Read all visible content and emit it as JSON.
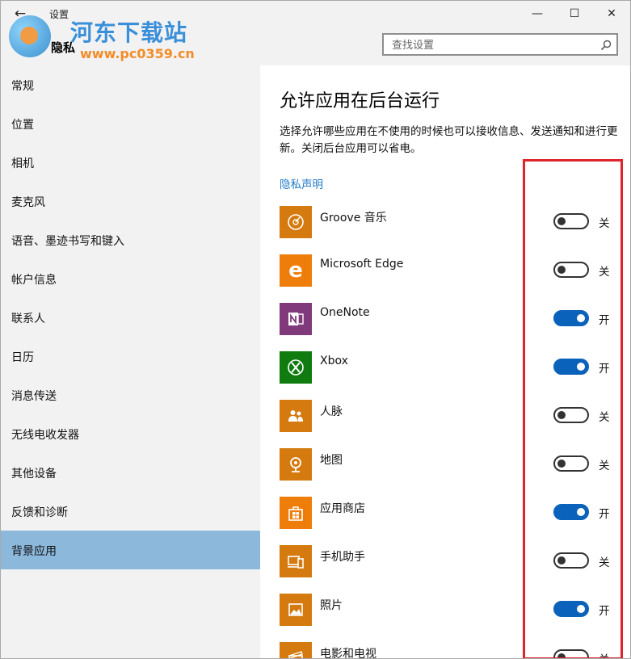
{
  "window": {
    "title": "设置",
    "section_title": "隐私",
    "back_glyph": "←",
    "minimize_glyph": "—",
    "maximize_glyph": "☐",
    "close_glyph": "✕"
  },
  "search": {
    "placeholder": "查找设置",
    "icon": "search-icon"
  },
  "watermark": {
    "name": "河东下载站",
    "url": "www.pc0359.cn"
  },
  "sidebar": {
    "items": [
      {
        "label": "常规",
        "selected": false
      },
      {
        "label": "位置",
        "selected": false
      },
      {
        "label": "相机",
        "selected": false
      },
      {
        "label": "麦克风",
        "selected": false
      },
      {
        "label": "语音、墨迹书写和键入",
        "selected": false
      },
      {
        "label": "帐户信息",
        "selected": false
      },
      {
        "label": "联系人",
        "selected": false
      },
      {
        "label": "日历",
        "selected": false
      },
      {
        "label": "消息传送",
        "selected": false
      },
      {
        "label": "无线电收发器",
        "selected": false
      },
      {
        "label": "其他设备",
        "selected": false
      },
      {
        "label": "反馈和诊断",
        "selected": false
      },
      {
        "label": "背景应用",
        "selected": true
      }
    ]
  },
  "main": {
    "title": "允许应用在后台运行",
    "description": "选择允许哪些应用在不使用的时候也可以接收信息、发送通知和进行更新。关闭后台应用可以省电。",
    "privacy_link": "隐私声明",
    "apps": [
      {
        "name": "Groove 音乐",
        "state": "关",
        "on": false,
        "icon": "music-disc-icon",
        "color": "#d47a0e"
      },
      {
        "name": "Microsoft Edge",
        "state": "关",
        "on": false,
        "icon": "edge-icon",
        "color": "#ef7d0a"
      },
      {
        "name": "OneNote",
        "state": "开",
        "on": true,
        "icon": "onenote-icon",
        "color": "#80397b"
      },
      {
        "name": "Xbox",
        "state": "开",
        "on": true,
        "icon": "xbox-icon",
        "color": "#107c10"
      },
      {
        "name": "人脉",
        "state": "关",
        "on": false,
        "icon": "people-icon",
        "color": "#d47a0e"
      },
      {
        "name": "地图",
        "state": "关",
        "on": false,
        "icon": "map-pin-icon",
        "color": "#d47a0e"
      },
      {
        "name": "应用商店",
        "state": "开",
        "on": true,
        "icon": "store-bag-icon",
        "color": "#ef7d0a"
      },
      {
        "name": "手机助手",
        "state": "关",
        "on": false,
        "icon": "phone-companion-icon",
        "color": "#d47a0e"
      },
      {
        "name": "照片",
        "state": "开",
        "on": true,
        "icon": "photo-icon",
        "color": "#d47a0e"
      },
      {
        "name": "电影和电视",
        "state": "关",
        "on": false,
        "icon": "film-icon",
        "color": "#d47a0e"
      }
    ]
  },
  "colors": {
    "accent": "#0a62ba",
    "selected_nav": "#8cb8dc",
    "link": "#1f7ac8",
    "highlight_box": "#e0242b"
  }
}
